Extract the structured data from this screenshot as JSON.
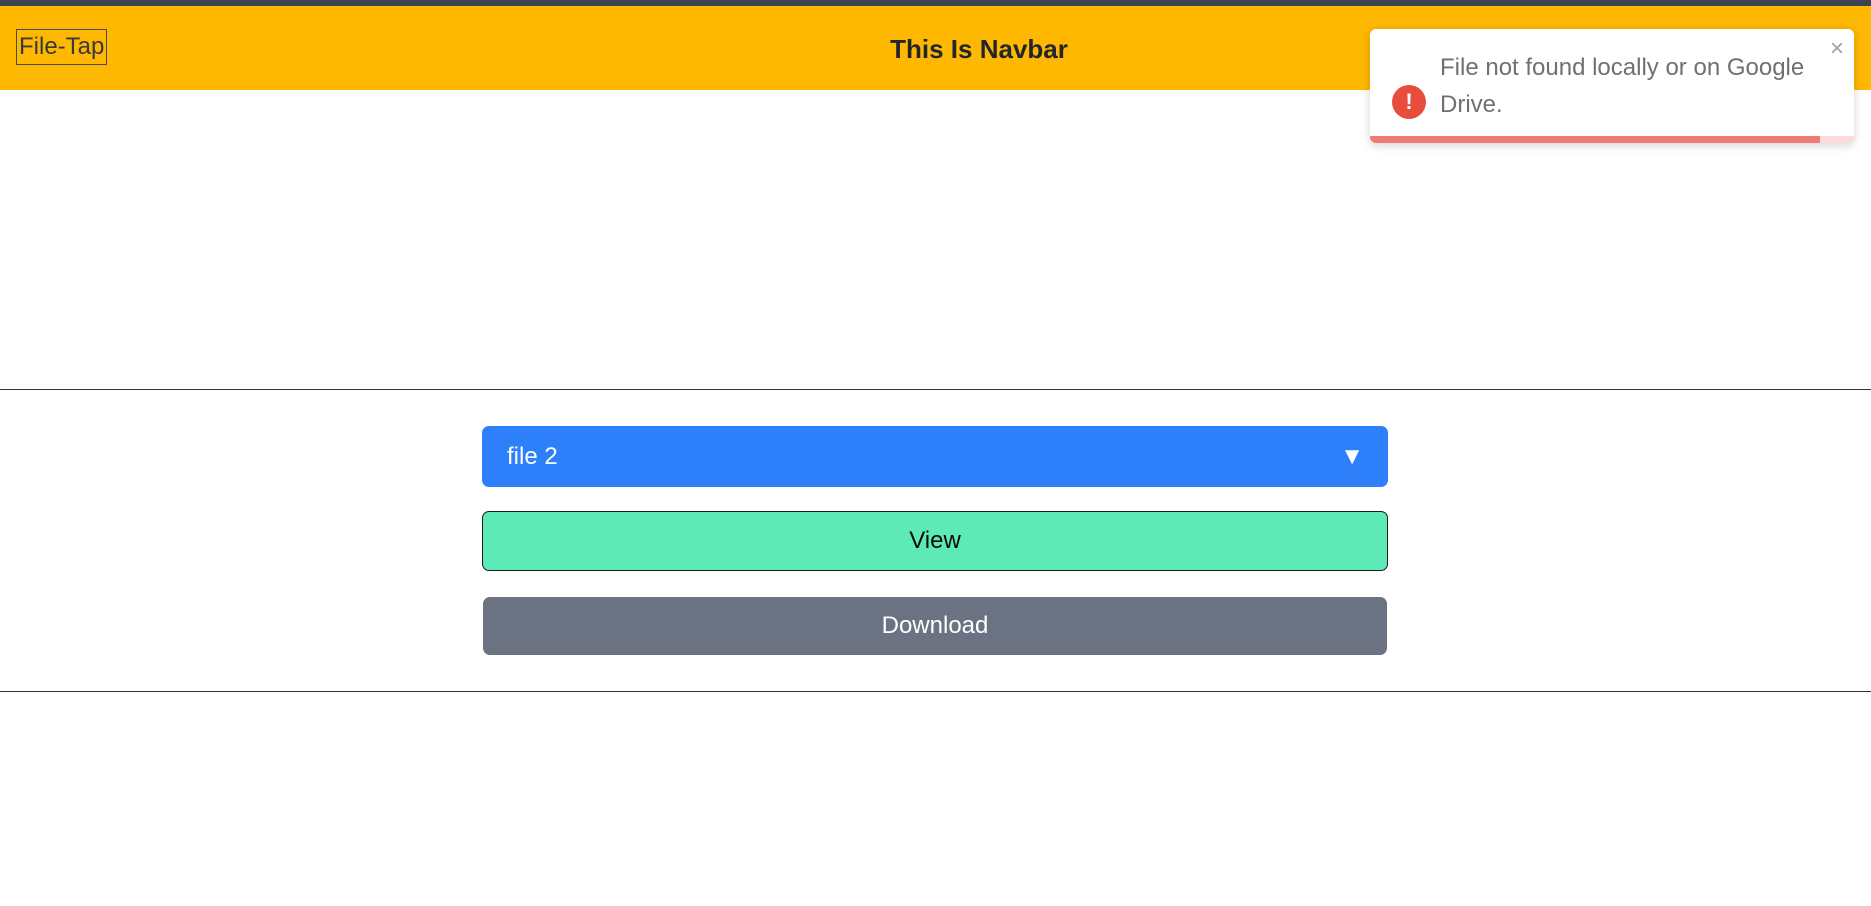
{
  "navbar": {
    "brand": "File-Tap",
    "title": "This Is Navbar",
    "background": "#ffb802"
  },
  "file_select": {
    "selected": "file 2",
    "arrow": "▼",
    "background": "#2d7ffa"
  },
  "actions": {
    "view_label": "View",
    "download_label": "Download",
    "view_color": "#5eeab6",
    "download_color": "#6b7282"
  },
  "toast": {
    "icon": "error-icon",
    "icon_glyph": "!",
    "message": "File not found locally or on Google Drive.",
    "close_glyph": "×",
    "progress_fraction": 0.93,
    "accent": "#e74c3c"
  }
}
